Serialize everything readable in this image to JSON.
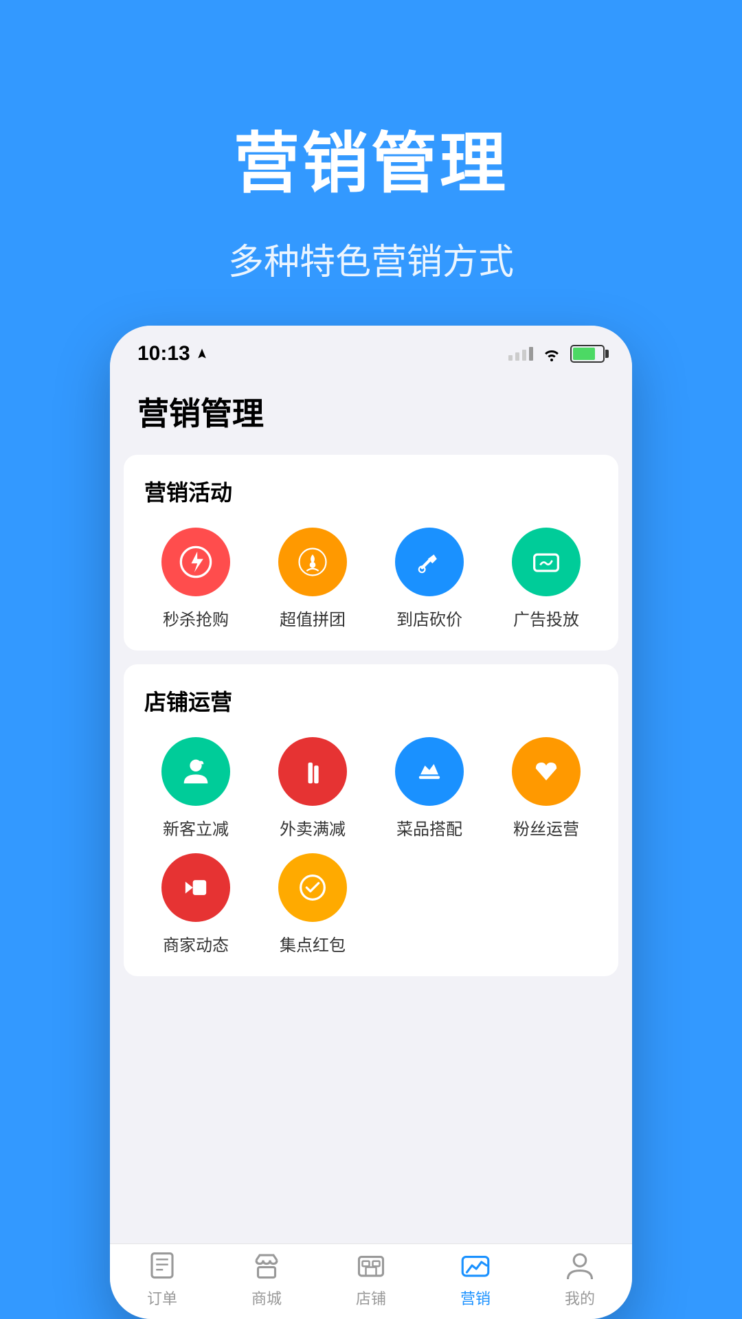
{
  "background_color": "#3399ff",
  "hero": {
    "title": "营销管理",
    "subtitle": "多种特色营销方式"
  },
  "phone": {
    "status_bar": {
      "time": "10:13",
      "location_icon": "▶"
    },
    "page_title": "营销管理",
    "sections": [
      {
        "id": "marketing-activity",
        "title": "营销活动",
        "items": [
          {
            "id": "flash-sale",
            "label": "秒杀抢购",
            "icon_color": "icon-red",
            "icon": "flash"
          },
          {
            "id": "group-buy",
            "label": "超值拼团",
            "icon_color": "icon-orange",
            "icon": "group"
          },
          {
            "id": "store-discount",
            "label": "到店砍价",
            "icon_color": "icon-blue",
            "icon": "scissor"
          },
          {
            "id": "ad-placement",
            "label": "广告投放",
            "icon_color": "icon-teal",
            "icon": "ad"
          }
        ]
      },
      {
        "id": "store-operation",
        "title": "店铺运营",
        "items": [
          {
            "id": "new-customer",
            "label": "新客立减",
            "icon_color": "icon-green",
            "icon": "person"
          },
          {
            "id": "delivery-discount",
            "label": "外卖满减",
            "icon_color": "icon-red-dark",
            "icon": "bars"
          },
          {
            "id": "dish-combo",
            "label": "菜品搭配",
            "icon_color": "icon-blue",
            "icon": "thumb"
          },
          {
            "id": "fan-operation",
            "label": "粉丝运营",
            "icon_color": "icon-orange",
            "icon": "heart"
          },
          {
            "id": "merchant-dynamic",
            "label": "商家动态",
            "icon_color": "icon-red-dark",
            "icon": "video"
          },
          {
            "id": "collect-points",
            "label": "集点红包",
            "icon_color": "icon-orange-gold",
            "icon": "check-circle"
          }
        ]
      }
    ],
    "nav": {
      "items": [
        {
          "id": "orders",
          "label": "订单",
          "active": false
        },
        {
          "id": "mall",
          "label": "商城",
          "active": false
        },
        {
          "id": "store",
          "label": "店铺",
          "active": false
        },
        {
          "id": "marketing",
          "label": "营销",
          "active": true
        },
        {
          "id": "mine",
          "label": "我的",
          "active": false
        }
      ]
    }
  }
}
